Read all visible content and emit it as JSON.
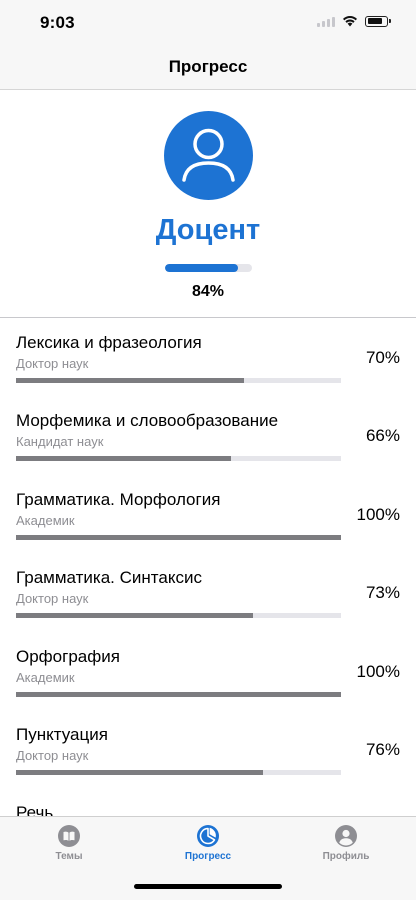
{
  "status": {
    "time": "9:03"
  },
  "nav": {
    "title": "Прогресс"
  },
  "profile": {
    "rank": "Доцент",
    "progress_fraction": 0.84,
    "progress_label": "84%",
    "accent_color": "#1d73d3"
  },
  "topics": [
    {
      "title": "Лексика и фразеология",
      "level": "Доктор наук",
      "percent_label": "70%",
      "fraction": 0.7
    },
    {
      "title": "Морфемика и словообразование",
      "level": "Кандидат наук",
      "percent_label": "66%",
      "fraction": 0.66
    },
    {
      "title": "Грамматика. Морфология",
      "level": "Академик",
      "percent_label": "100%",
      "fraction": 1.0
    },
    {
      "title": "Грамматика. Синтаксис",
      "level": "Доктор наук",
      "percent_label": "73%",
      "fraction": 0.73
    },
    {
      "title": "Орфография",
      "level": "Академик",
      "percent_label": "100%",
      "fraction": 1.0
    },
    {
      "title": "Пунктуация",
      "level": "Доктор наук",
      "percent_label": "76%",
      "fraction": 0.76
    },
    {
      "title": "Речь",
      "level": "",
      "percent_label": "",
      "fraction": 0
    }
  ],
  "tabs": [
    {
      "label": "Темы",
      "icon": "book-icon",
      "active": false
    },
    {
      "label": "Прогресс",
      "icon": "pie-chart-icon",
      "active": true
    },
    {
      "label": "Профиль",
      "icon": "person-circle-icon",
      "active": false
    }
  ]
}
